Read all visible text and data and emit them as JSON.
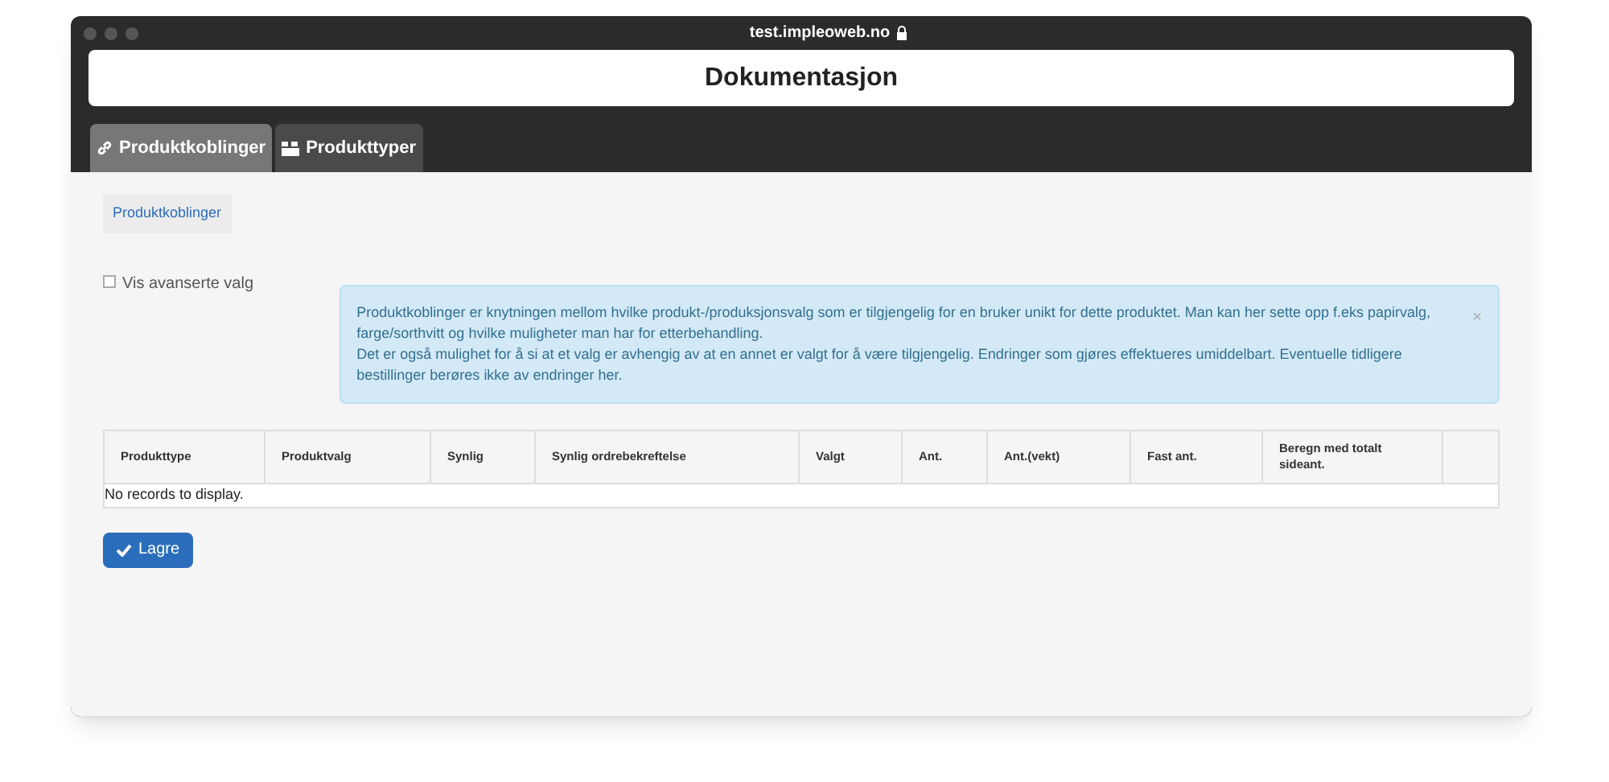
{
  "window": {
    "url": "test.impleoweb.no",
    "title": "Dokumentasjon"
  },
  "tabs": [
    {
      "label": "Produktkoblinger",
      "selected": true
    },
    {
      "label": "Produkttyper",
      "selected": false
    }
  ],
  "breadcrumb": "Produktkoblinger",
  "advanced": {
    "label": "Vis avanserte valg",
    "checked": false
  },
  "info": {
    "paragraphs": [
      "Produktkoblinger er knytningen mellom hvilke produkt-/produksjonsvalg som er tilgjengelig for en bruker unikt for dette produktet. Man kan her sette opp f.eks papirvalg, farge/sorthvitt og hvilke muligheter man har for etterbehandling.",
      "Det er også mulighet for å si at et valg er avhengig av at en annet er valgt for å være tilgjengelig. Endringer som gjøres effektueres umiddelbart. Eventuelle tidligere bestillinger berøres ikke av endringer her."
    ],
    "close": "×"
  },
  "table": {
    "columns": [
      "Produkttype",
      "Produktvalg",
      "Synlig",
      "Synlig ordrebekreftelse",
      "Valgt",
      "Ant.",
      "Ant.(vekt)",
      "Fast ant.",
      "Beregn med totalt sideant."
    ],
    "empty": "No records to display."
  },
  "save_button": "Lagre"
}
